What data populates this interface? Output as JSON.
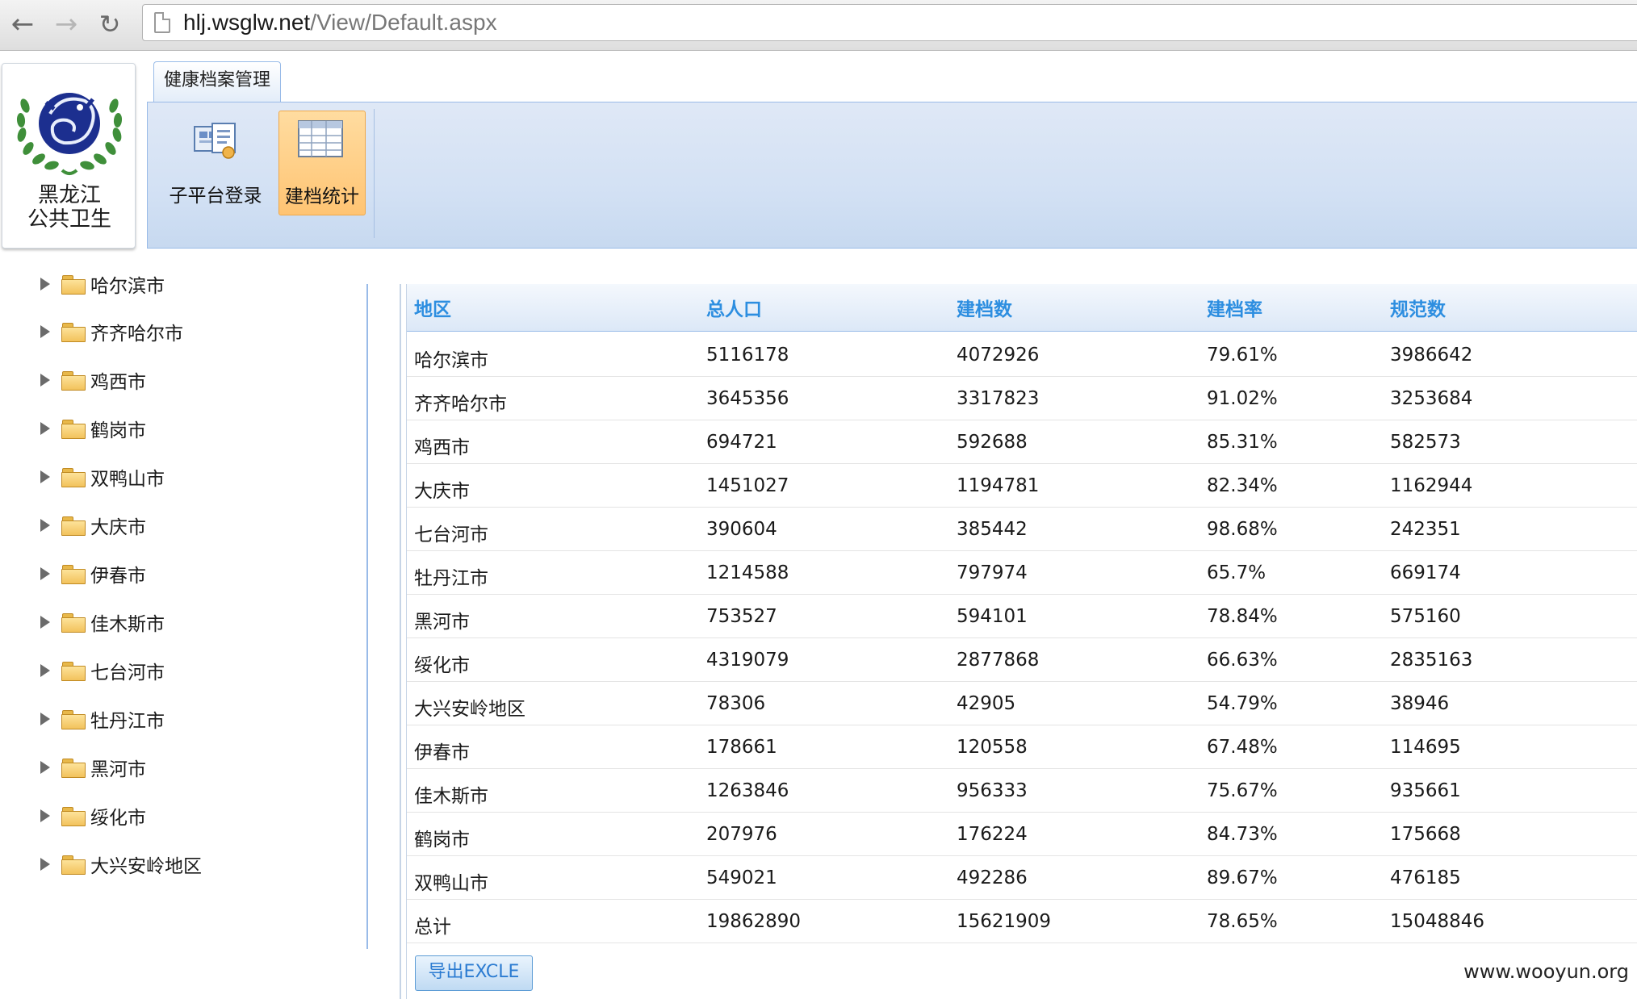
{
  "browser": {
    "url_host": "hlj.wsglw.net",
    "url_path": "/View/Default.aspx"
  },
  "logo": {
    "line1": "黑龙江",
    "line2": "公共卫生"
  },
  "ribbon": {
    "tab_label": "健康档案管理",
    "buttons": [
      {
        "label": "子平台登录",
        "icon": "sub-platform-login-icon"
      },
      {
        "label": "建档统计",
        "icon": "statistics-table-icon"
      }
    ]
  },
  "tree": {
    "items": [
      {
        "label": "哈尔滨市"
      },
      {
        "label": "齐齐哈尔市"
      },
      {
        "label": "鸡西市"
      },
      {
        "label": "鹤岗市"
      },
      {
        "label": "双鸭山市"
      },
      {
        "label": "大庆市"
      },
      {
        "label": "伊春市"
      },
      {
        "label": "佳木斯市"
      },
      {
        "label": "七台河市"
      },
      {
        "label": "牡丹江市"
      },
      {
        "label": "黑河市"
      },
      {
        "label": "绥化市"
      },
      {
        "label": "大兴安岭地区"
      }
    ]
  },
  "grid": {
    "columns": [
      "地区",
      "总人口",
      "建档数",
      "建档率",
      "规范数"
    ],
    "rows": [
      [
        "哈尔滨市",
        "5116178",
        "4072926",
        "79.61%",
        "3986642"
      ],
      [
        "齐齐哈尔市",
        "3645356",
        "3317823",
        "91.02%",
        "3253684"
      ],
      [
        "鸡西市",
        "694721",
        "592688",
        "85.31%",
        "582573"
      ],
      [
        "大庆市",
        "1451027",
        "1194781",
        "82.34%",
        "1162944"
      ],
      [
        "七台河市",
        "390604",
        "385442",
        "98.68%",
        "242351"
      ],
      [
        "牡丹江市",
        "1214588",
        "797974",
        "65.7%",
        "669174"
      ],
      [
        "黑河市",
        "753527",
        "594101",
        "78.84%",
        "575160"
      ],
      [
        "绥化市",
        "4319079",
        "2877868",
        "66.63%",
        "2835163"
      ],
      [
        "大兴安岭地区",
        "78306",
        "42905",
        "54.79%",
        "38946"
      ],
      [
        "伊春市",
        "178661",
        "120558",
        "67.48%",
        "114695"
      ],
      [
        "佳木斯市",
        "1263846",
        "956333",
        "75.67%",
        "935661"
      ],
      [
        "鹤岗市",
        "207976",
        "176224",
        "84.73%",
        "175668"
      ],
      [
        "双鸭山市",
        "549021",
        "492286",
        "89.67%",
        "476185"
      ],
      [
        "总计",
        "19862890",
        "15621909",
        "78.65%",
        "15048846"
      ]
    ],
    "export_label": "导出EXCLE"
  },
  "watermark": "www.wooyun.org",
  "colors": {
    "header_text": "#2d8ee0",
    "active_button": "#ffc473",
    "ribbon_bg": "#d3e1f4"
  }
}
